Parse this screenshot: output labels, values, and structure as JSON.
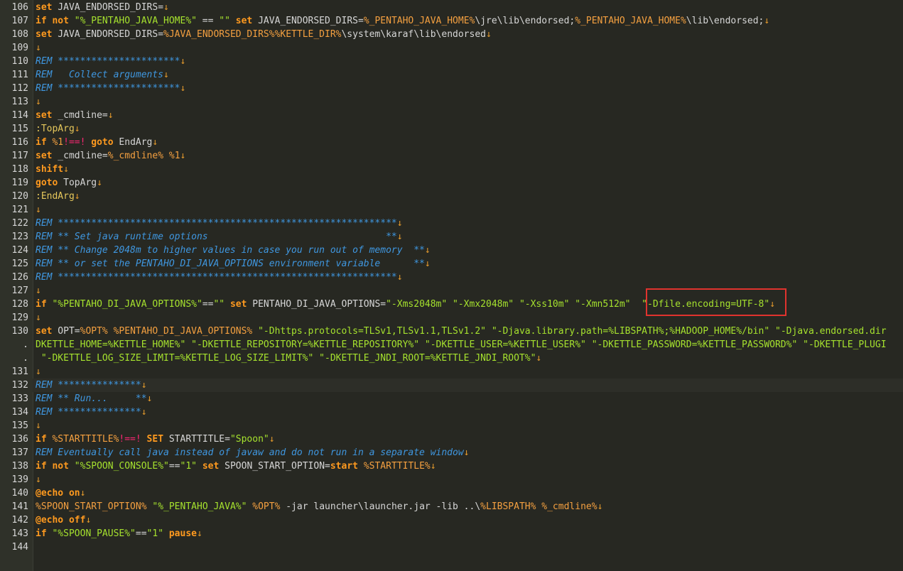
{
  "eol_glyph": "↓",
  "colors": {
    "background": "#272822",
    "keyword": "#ff9a1f",
    "string": "#a6e22e",
    "comment": "#3f97e0",
    "annotation_box": "#e0332e"
  },
  "lines": [
    {
      "n": "106",
      "eol": true,
      "t": [
        [
          "kw",
          "set"
        ],
        [
          "plain",
          " JAVA_ENDORSED_DIRS="
        ]
      ]
    },
    {
      "n": "107",
      "eol": true,
      "t": [
        [
          "kw",
          "if not"
        ],
        [
          "plain",
          " "
        ],
        [
          "str",
          "\"%_PENTAHO_JAVA_HOME%\""
        ],
        [
          "plain",
          " == "
        ],
        [
          "str",
          "\"\""
        ],
        [
          "plain",
          " "
        ],
        [
          "kw",
          "set"
        ],
        [
          "plain",
          " JAVA_ENDORSED_DIRS="
        ],
        [
          "var",
          "%_PENTAHO_JAVA_HOME%"
        ],
        [
          "plain",
          "\\jre\\lib\\endorsed;"
        ],
        [
          "var",
          "%_PENTAHO_JAVA_HOME%"
        ],
        [
          "plain",
          "\\lib\\endorsed;"
        ]
      ]
    },
    {
      "n": "108",
      "eol": true,
      "t": [
        [
          "kw",
          "set"
        ],
        [
          "plain",
          " JAVA_ENDORSED_DIRS="
        ],
        [
          "var",
          "%JAVA_ENDORSED_DIRS%%KETTLE_DIR%"
        ],
        [
          "plain",
          "\\system\\karaf\\lib\\endorsed"
        ]
      ]
    },
    {
      "n": "109",
      "eol": true,
      "t": []
    },
    {
      "n": "110",
      "eol": true,
      "t": [
        [
          "cmt",
          "REM **********************"
        ]
      ]
    },
    {
      "n": "111",
      "eol": true,
      "t": [
        [
          "cmt",
          "REM   Collect arguments"
        ]
      ]
    },
    {
      "n": "112",
      "eol": true,
      "t": [
        [
          "cmt",
          "REM **********************"
        ]
      ]
    },
    {
      "n": "113",
      "eol": true,
      "t": []
    },
    {
      "n": "114",
      "eol": true,
      "t": [
        [
          "kw",
          "set"
        ],
        [
          "plain",
          " _cmdline="
        ]
      ]
    },
    {
      "n": "115",
      "eol": true,
      "t": [
        [
          "lbl",
          ":TopArg"
        ]
      ]
    },
    {
      "n": "116",
      "eol": true,
      "t": [
        [
          "kw",
          "if"
        ],
        [
          "plain",
          " "
        ],
        [
          "var",
          "%1"
        ],
        [
          "op",
          "!==!"
        ],
        [
          "plain",
          " "
        ],
        [
          "kw",
          "goto"
        ],
        [
          "plain",
          " EndArg"
        ]
      ]
    },
    {
      "n": "117",
      "eol": true,
      "t": [
        [
          "kw",
          "set"
        ],
        [
          "plain",
          " _cmdline="
        ],
        [
          "var",
          "%_cmdline%"
        ],
        [
          "plain",
          " "
        ],
        [
          "var",
          "%1"
        ]
      ]
    },
    {
      "n": "118",
      "eol": true,
      "t": [
        [
          "kw",
          "shift"
        ]
      ]
    },
    {
      "n": "119",
      "eol": true,
      "t": [
        [
          "kw",
          "goto"
        ],
        [
          "plain",
          " TopArg"
        ]
      ]
    },
    {
      "n": "120",
      "eol": true,
      "t": [
        [
          "lbl",
          ":EndArg"
        ]
      ]
    },
    {
      "n": "121",
      "eol": true,
      "t": []
    },
    {
      "n": "122",
      "eol": true,
      "t": [
        [
          "cmt",
          "REM *************************************************************"
        ]
      ]
    },
    {
      "n": "123",
      "eol": true,
      "t": [
        [
          "cmt",
          "REM ** Set java runtime options                                **"
        ]
      ]
    },
    {
      "n": "124",
      "eol": true,
      "t": [
        [
          "cmt",
          "REM ** Change 2048m to higher values in case you run out of memory  **"
        ]
      ]
    },
    {
      "n": "125",
      "eol": true,
      "t": [
        [
          "cmt",
          "REM ** or set the PENTAHO_DI_JAVA_OPTIONS environment variable      **"
        ]
      ]
    },
    {
      "n": "126",
      "eol": true,
      "t": [
        [
          "cmt",
          "REM *************************************************************"
        ]
      ]
    },
    {
      "n": "127",
      "eol": true,
      "t": []
    },
    {
      "n": "128",
      "eol": true,
      "t": [
        [
          "kw",
          "if"
        ],
        [
          "plain",
          " "
        ],
        [
          "str",
          "\"%PENTAHO_DI_JAVA_OPTIONS%\""
        ],
        [
          "plain",
          "=="
        ],
        [
          "str",
          "\"\""
        ],
        [
          "plain",
          " "
        ],
        [
          "kw",
          "set"
        ],
        [
          "plain",
          " PENTAHO_DI_JAVA_OPTIONS="
        ],
        [
          "str",
          "\"-Xms2048m\""
        ],
        [
          "plain",
          " "
        ],
        [
          "str",
          "\"-Xmx2048m\""
        ],
        [
          "plain",
          " "
        ],
        [
          "str",
          "\"-Xss10m\""
        ],
        [
          "plain",
          " "
        ],
        [
          "str",
          "\"-Xmn512m\""
        ],
        [
          "plain",
          "  "
        ],
        [
          "str",
          "\"-Dfile.encoding=UTF-8\""
        ]
      ]
    },
    {
      "n": "129",
      "eol": true,
      "t": []
    },
    {
      "n": "130",
      "eol": false,
      "t": [
        [
          "kw",
          "set"
        ],
        [
          "plain",
          " OPT="
        ],
        [
          "var",
          "%OPT%"
        ],
        [
          "plain",
          " "
        ],
        [
          "var",
          "%PENTAHO_DI_JAVA_OPTIONS%"
        ],
        [
          "plain",
          " "
        ],
        [
          "str",
          "\"-Dhttps.protocols=TLSv1,TLSv1.1,TLSv1.2\""
        ],
        [
          "plain",
          " "
        ],
        [
          "str",
          "\"-Djava.library.path=%LIBSPATH%;%HADOOP_HOME%/bin\""
        ],
        [
          "plain",
          " "
        ],
        [
          "str",
          "\"-Djava.endorsed.dir"
        ]
      ]
    },
    {
      "n": ".",
      "eol": false,
      "t": [
        [
          "str",
          "DKETTLE_HOME=%KETTLE_HOME%\""
        ],
        [
          "plain",
          " "
        ],
        [
          "str",
          "\"-DKETTLE_REPOSITORY=%KETTLE_REPOSITORY%\""
        ],
        [
          "plain",
          " "
        ],
        [
          "str",
          "\"-DKETTLE_USER=%KETTLE_USER%\""
        ],
        [
          "plain",
          " "
        ],
        [
          "str",
          "\"-DKETTLE_PASSWORD=%KETTLE_PASSWORD%\""
        ],
        [
          "plain",
          " "
        ],
        [
          "str",
          "\"-DKETTLE_PLUGI"
        ]
      ]
    },
    {
      "n": ".",
      "eol": true,
      "t": [
        [
          "plain",
          " "
        ],
        [
          "str",
          "\"-DKETTLE_LOG_SIZE_LIMIT=%KETTLE_LOG_SIZE_LIMIT%\""
        ],
        [
          "plain",
          " "
        ],
        [
          "str",
          "\"-DKETTLE_JNDI_ROOT=%KETTLE_JNDI_ROOT%\""
        ]
      ]
    },
    {
      "n": "131",
      "eol": true,
      "t": []
    },
    {
      "n": "132",
      "eol": true,
      "current": true,
      "t": [
        [
          "cmt",
          "REM ***************"
        ]
      ]
    },
    {
      "n": "133",
      "eol": true,
      "t": [
        [
          "cmt",
          "REM ** Run...     **"
        ]
      ]
    },
    {
      "n": "134",
      "eol": true,
      "t": [
        [
          "cmt",
          "REM ***************"
        ]
      ]
    },
    {
      "n": "135",
      "eol": true,
      "t": []
    },
    {
      "n": "136",
      "eol": true,
      "t": [
        [
          "kw",
          "if"
        ],
        [
          "plain",
          " "
        ],
        [
          "var",
          "%STARTTITLE%"
        ],
        [
          "op",
          "!==!"
        ],
        [
          "plain",
          " "
        ],
        [
          "kw",
          "SET"
        ],
        [
          "plain",
          " STARTTITLE="
        ],
        [
          "str",
          "\"Spoon\""
        ]
      ]
    },
    {
      "n": "137",
      "eol": true,
      "t": [
        [
          "cmt",
          "REM Eventually call java instead of javaw and do not run in a separate window"
        ]
      ]
    },
    {
      "n": "138",
      "eol": true,
      "t": [
        [
          "kw",
          "if not"
        ],
        [
          "plain",
          " "
        ],
        [
          "str",
          "\"%SPOON_CONSOLE%\""
        ],
        [
          "plain",
          "=="
        ],
        [
          "str",
          "\"1\""
        ],
        [
          "plain",
          " "
        ],
        [
          "kw",
          "set"
        ],
        [
          "plain",
          " SPOON_START_OPTION="
        ],
        [
          "kw",
          "start"
        ],
        [
          "plain",
          " "
        ],
        [
          "var",
          "%STARTTITLE%"
        ]
      ]
    },
    {
      "n": "139",
      "eol": true,
      "t": []
    },
    {
      "n": "140",
      "eol": true,
      "t": [
        [
          "kw",
          "@echo on"
        ]
      ]
    },
    {
      "n": "141",
      "eol": true,
      "t": [
        [
          "var",
          "%SPOON_START_OPTION%"
        ],
        [
          "plain",
          " "
        ],
        [
          "str",
          "\"%_PENTAHO_JAVA%\""
        ],
        [
          "plain",
          " "
        ],
        [
          "var",
          "%OPT%"
        ],
        [
          "plain",
          " -jar launcher\\launcher.jar -lib ..\\"
        ],
        [
          "var",
          "%LIBSPATH%"
        ],
        [
          "plain",
          " "
        ],
        [
          "var",
          "%_cmdline%"
        ]
      ]
    },
    {
      "n": "142",
      "eol": true,
      "t": [
        [
          "kw",
          "@echo off"
        ]
      ]
    },
    {
      "n": "143",
      "eol": true,
      "t": [
        [
          "kw",
          "if"
        ],
        [
          "plain",
          " "
        ],
        [
          "str",
          "\"%SPOON_PAUSE%\""
        ],
        [
          "plain",
          "=="
        ],
        [
          "str",
          "\"1\""
        ],
        [
          "plain",
          " "
        ],
        [
          "kw",
          "pause"
        ]
      ]
    },
    {
      "n": "144",
      "eol": false,
      "t": []
    }
  ]
}
